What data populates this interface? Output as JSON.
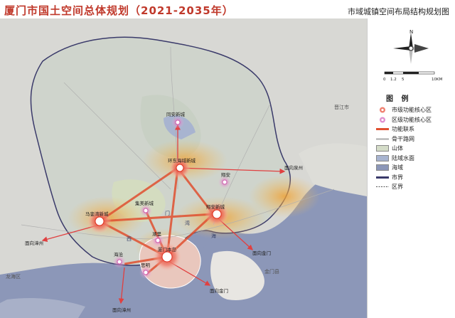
{
  "header": {
    "title": "厦门市国土空间总体规划（2021-2035年）",
    "subtitle": "市域城镇空间布局结构规划图"
  },
  "compass": {
    "north": "N"
  },
  "scale": {
    "ticks": [
      "0",
      "1.2",
      "5",
      "10KM"
    ]
  },
  "legend": {
    "title": "图 例",
    "items": [
      {
        "label": "市级功能核心区",
        "icon": "city-core-icon"
      },
      {
        "label": "区级功能核心区",
        "icon": "district-core-icon"
      },
      {
        "label": "功能联系",
        "icon": "function-link-icon"
      },
      {
        "label": "骨干路网",
        "icon": "road-network-icon"
      },
      {
        "label": "山体",
        "icon": "mountain-icon"
      },
      {
        "label": "陆域水面",
        "icon": "land-water-icon"
      },
      {
        "label": "海域",
        "icon": "sea-area-icon"
      },
      {
        "label": "市界",
        "icon": "city-boundary-icon"
      },
      {
        "label": "区界",
        "icon": "district-boundary-icon"
      }
    ]
  },
  "map": {
    "cores": [
      {
        "label": "同安新城",
        "level": "district"
      },
      {
        "label": "环东海域新城",
        "level": "city"
      },
      {
        "label": "翔安",
        "level": "district"
      },
      {
        "label": "集美新城",
        "level": "district"
      },
      {
        "label": "马銮湾新城",
        "level": "city"
      },
      {
        "label": "翔安新城",
        "level": "city"
      },
      {
        "label": "湖里",
        "level": "district"
      },
      {
        "label": "厦门本岛",
        "level": "city"
      },
      {
        "label": "海沧",
        "level": "district"
      },
      {
        "label": "思明",
        "level": "district"
      }
    ],
    "directions": [
      "面向泉州",
      "面向漳州",
      "面向金门",
      "面向金门",
      "面向漳州"
    ],
    "water_labels": [
      "西",
      "门",
      "湾",
      "海"
    ],
    "place_labels": [
      "晋江市",
      "金门县",
      "龙海区"
    ]
  }
}
